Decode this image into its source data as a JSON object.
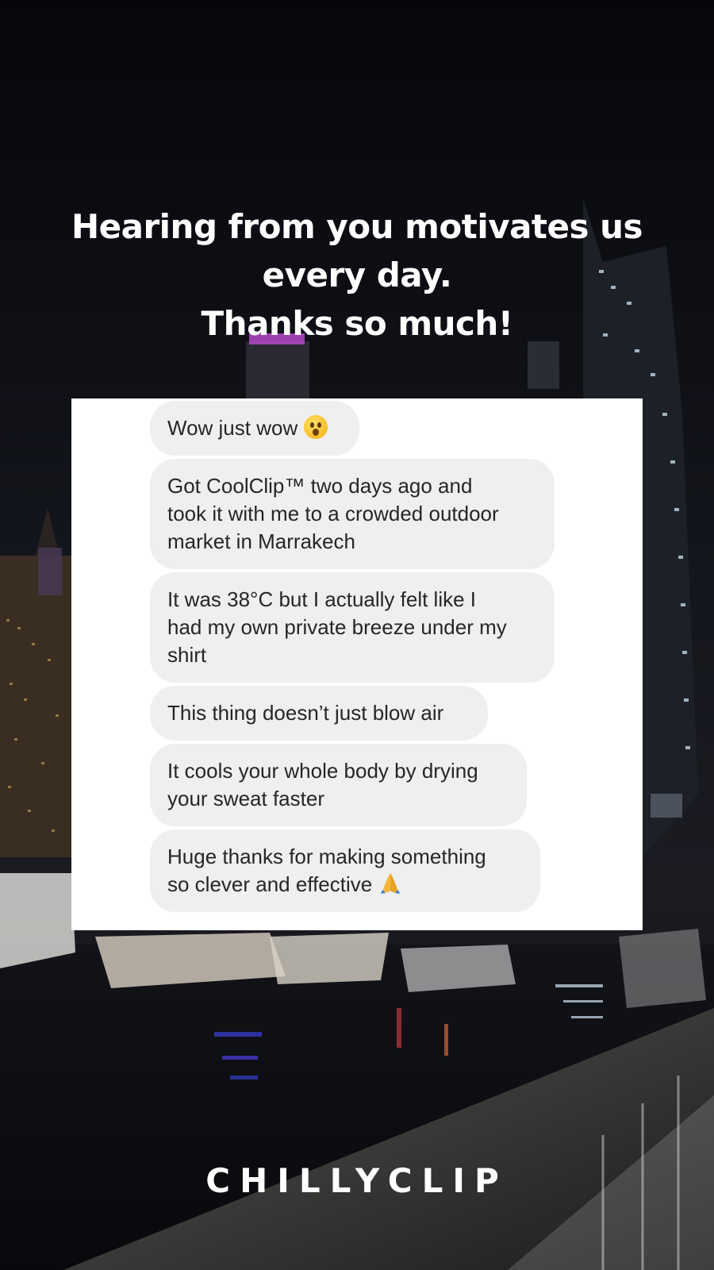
{
  "headline": {
    "line1": "Hearing from you motivates us",
    "line2": "every day.",
    "line3": "Thanks so much!"
  },
  "messages": [
    {
      "text": "Wow just wow",
      "emoji": "astonished-face-icon"
    },
    {
      "line1": "Got CoolClip™ two days ago and",
      "line2": "took it with me to a crowded outdoor",
      "line3": "market in Marrakech"
    },
    {
      "line1": "It was 38°C but I actually felt like I",
      "line2": "had my own private breeze under my",
      "line3": "shirt"
    },
    {
      "text": "This thing doesn’t just blow air"
    },
    {
      "line1": "It cools your whole body by drying",
      "line2": "your sweat faster"
    },
    {
      "line1": "Huge thanks for making something",
      "line2": "so clever and effective",
      "emoji": "folded-hands-icon"
    }
  ],
  "brand": "CHILLYCLIP",
  "colors": {
    "bubble": "#efefef",
    "card": "#ffffff",
    "text_dark": "#262626",
    "headline": "#ffffff"
  }
}
